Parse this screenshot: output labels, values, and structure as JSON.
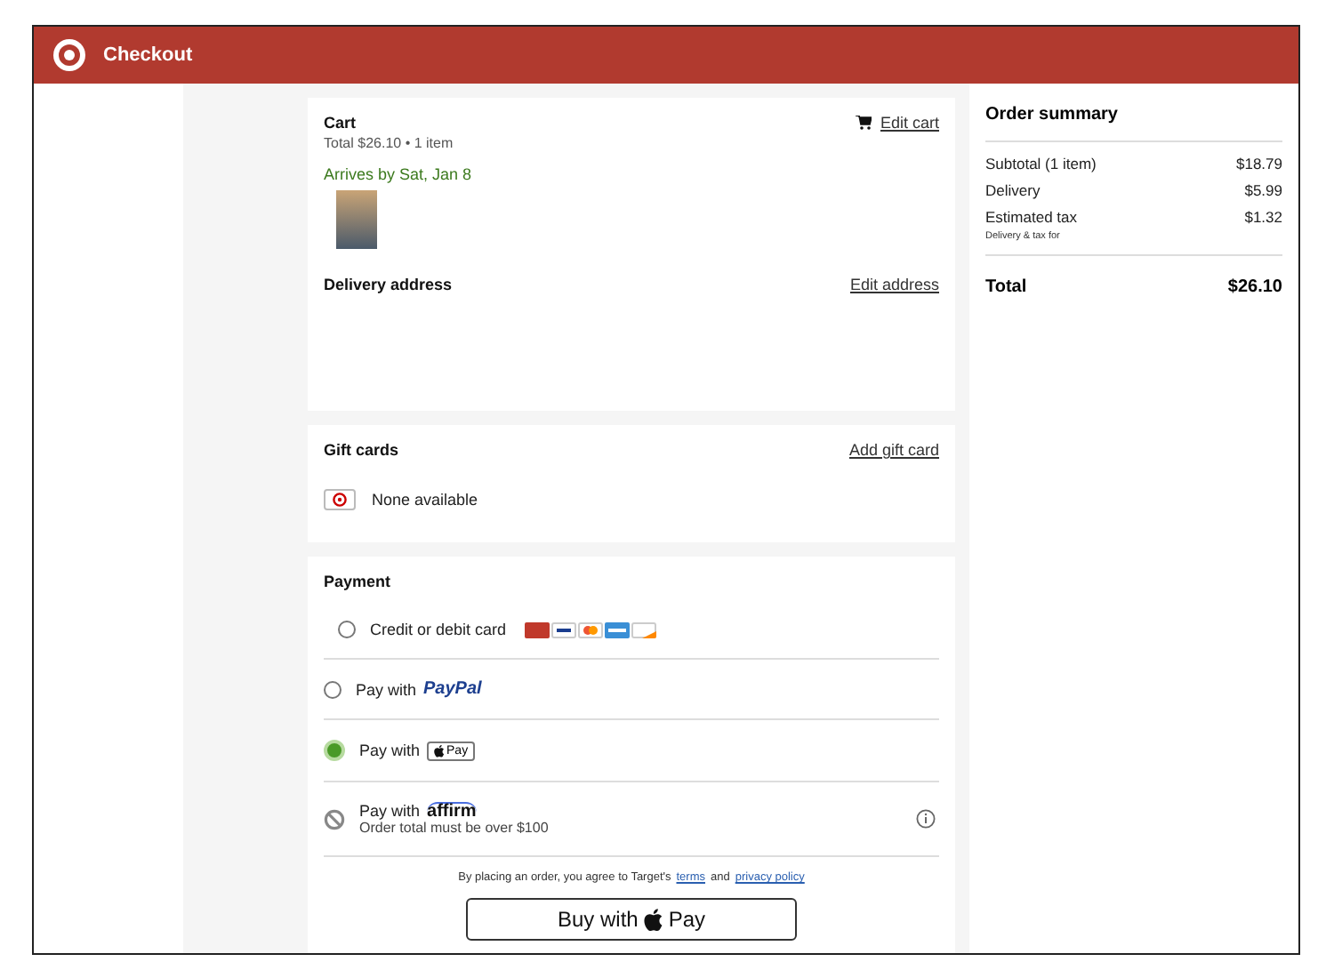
{
  "header": {
    "title": "Checkout"
  },
  "cart": {
    "title": "Cart",
    "summary": "Total $26.10 • 1 item",
    "edit_link": "Edit cart",
    "arrival": "Arrives by Sat, Jan 8"
  },
  "delivery": {
    "title": "Delivery address",
    "edit_link": "Edit address"
  },
  "gift_cards": {
    "title": "Gift cards",
    "add_link": "Add gift card",
    "status": "None available"
  },
  "payment": {
    "title": "Payment",
    "methods": [
      {
        "kind": "card",
        "label": "Credit or debit card",
        "selected": false,
        "disabled": false
      },
      {
        "kind": "paypal",
        "label": "Pay with",
        "logo": "PayPal",
        "selected": false,
        "disabled": false
      },
      {
        "kind": "applepay",
        "label": "Pay with",
        "logo": "Pay",
        "selected": true,
        "disabled": false
      },
      {
        "kind": "affirm",
        "label": "Pay with",
        "logo": "affirm",
        "note": "Order total must be over $100",
        "selected": false,
        "disabled": true
      }
    ],
    "legal": {
      "before": "By placing an order, you agree to Target's",
      "terms": "terms",
      "middle": "and",
      "privacy": "privacy policy"
    },
    "buy_button": {
      "before": "Buy with",
      "after": "Pay"
    }
  },
  "order_summary": {
    "title": "Order summary",
    "lines": [
      {
        "label": "Subtotal (1 item)",
        "value": "$18.79"
      },
      {
        "label": "Delivery",
        "value": "$5.99"
      },
      {
        "label": "Estimated tax",
        "value": "$1.32"
      }
    ],
    "note": "Delivery & tax for",
    "total_label": "Total",
    "total_value": "$26.10"
  }
}
